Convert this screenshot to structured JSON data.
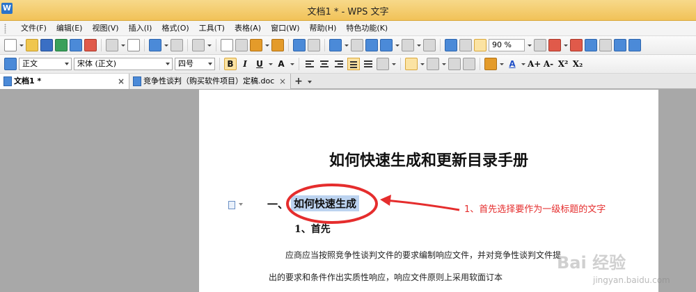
{
  "window": {
    "title": "文档1 * - WPS 文字",
    "logo": "W"
  },
  "menu": [
    "文件(F)",
    "编辑(E)",
    "视图(V)",
    "插入(I)",
    "格式(O)",
    "工具(T)",
    "表格(A)",
    "窗口(W)",
    "帮助(H)",
    "特色功能(K)"
  ],
  "toolbar": {
    "zoom": "90 %"
  },
  "format_bar": {
    "style": "正文",
    "font": "宋体 (正文)",
    "size": "四号",
    "bold": "B",
    "italic": "I",
    "underline": "U",
    "font_color_letter": "A",
    "grow_font": "A+",
    "shrink_font": "A-",
    "superscript": "X²",
    "subscript": "X₂"
  },
  "tabs": [
    {
      "label": "文档1 *",
      "close": "×"
    },
    {
      "label": "竞争性谈判（购买软件项目）定稿.doc",
      "close": "×"
    }
  ],
  "tab_add": "+",
  "document": {
    "title": "如何快速生成和更新目录手册",
    "h1_prefix": "一、",
    "h1_text": "如何快速生成",
    "h2": "1、首先",
    "body_lines": [
      "应商应当按照竞争性谈判文件的要求编制响应文件，并对竞争性谈判文件提",
      "出的要求和条件作出实质性响应，响应文件原则上采用软面订本"
    ]
  },
  "annotation": {
    "text": "1、首先选择要作为一级标题的文字",
    "color": "#e52d2d"
  },
  "watermark": {
    "text": "Bai 经验",
    "url": "jingyan.baidu.com"
  }
}
